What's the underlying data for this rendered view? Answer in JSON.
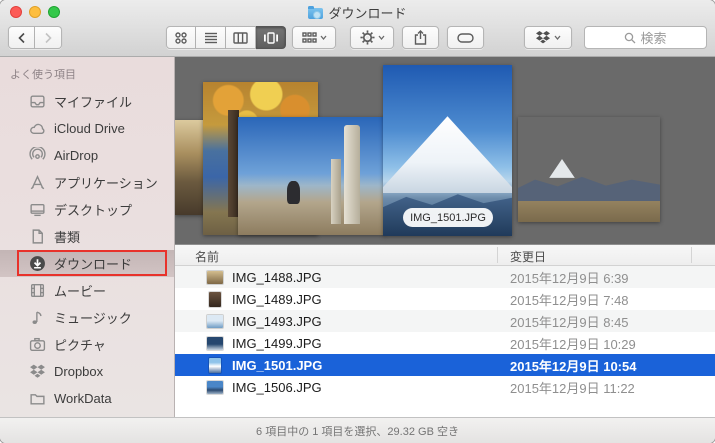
{
  "window": {
    "title": "ダウンロード"
  },
  "toolbar": {
    "search_placeholder": "検索"
  },
  "sidebar": {
    "section_header": "よく使う項目",
    "items": [
      {
        "label": "マイファイル",
        "icon": "myfiles-icon",
        "selected": false
      },
      {
        "label": "iCloud Drive",
        "icon": "icloud-icon",
        "selected": false
      },
      {
        "label": "AirDrop",
        "icon": "airdrop-icon",
        "selected": false
      },
      {
        "label": "アプリケーション",
        "icon": "applications-icon",
        "selected": false
      },
      {
        "label": "デスクトップ",
        "icon": "desktop-icon",
        "selected": false
      },
      {
        "label": "書類",
        "icon": "documents-icon",
        "selected": false
      },
      {
        "label": "ダウンロード",
        "icon": "downloads-icon",
        "selected": true,
        "annotated_with_red_box": true
      },
      {
        "label": "ムービー",
        "icon": "movies-icon",
        "selected": false
      },
      {
        "label": "ミュージック",
        "icon": "music-icon",
        "selected": false
      },
      {
        "label": "ピクチャ",
        "icon": "pictures-icon",
        "selected": false
      },
      {
        "label": "Dropbox",
        "icon": "dropbox-icon",
        "selected": false
      },
      {
        "label": "WorkData",
        "icon": "workdata-icon",
        "selected": false
      }
    ]
  },
  "coverflow": {
    "selected_file_label": "IMG_1501.JPG"
  },
  "list": {
    "columns": [
      {
        "label": "名前"
      },
      {
        "label": "変更日"
      }
    ],
    "rows": [
      {
        "name": "IMG_1488.JPG",
        "date": "2015年12月9日 6:39",
        "selected": false
      },
      {
        "name": "IMG_1489.JPG",
        "date": "2015年12月9日 7:48",
        "selected": false
      },
      {
        "name": "IMG_1493.JPG",
        "date": "2015年12月9日 8:45",
        "selected": false
      },
      {
        "name": "IMG_1499.JPG",
        "date": "2015年12月9日 10:29",
        "selected": false
      },
      {
        "name": "IMG_1501.JPG",
        "date": "2015年12月9日 10:54",
        "selected": true
      },
      {
        "name": "IMG_1506.JPG",
        "date": "2015年12月9日 11:22",
        "selected": false
      }
    ]
  },
  "statusbar": {
    "text": "6 項目中の 1 項目を選択、29.32 GB 空き"
  },
  "colors": {
    "selection_blue": "#1a62d9",
    "annotation_red": "#e8322b",
    "coverflow_background": "#6a6a6a",
    "sidebar_tint": "#e9dcdc"
  }
}
